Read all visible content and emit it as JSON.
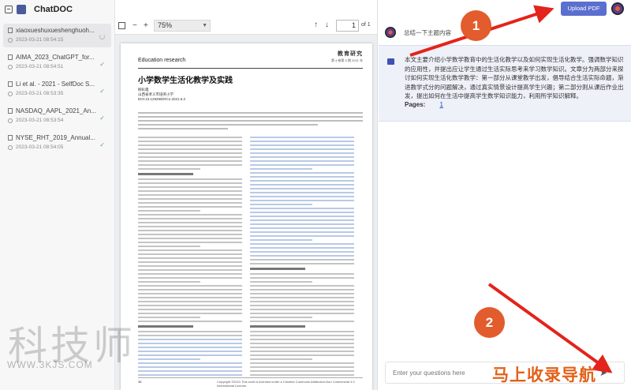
{
  "app": {
    "title": "ChatDOC"
  },
  "sidebar": {
    "items": [
      {
        "name": "xiaoxueshuxueshenghuoh...",
        "time": "2023-03-21 08:54:15",
        "status": "loading",
        "active": true
      },
      {
        "name": "AIMA_2023_ChatGPT_for...",
        "time": "2023-03-21 08:54:51",
        "status": "done",
        "active": false
      },
      {
        "name": "Li et al. - 2021 - SelfDoc S...",
        "time": "2023-03-21 08:53:35",
        "status": "done",
        "active": false
      },
      {
        "name": "NASDAQ_AAPL_2021_An...",
        "time": "2023-03-21 08:53:54",
        "status": "done",
        "active": false
      },
      {
        "name": "NYSE_RHT_2019_Annual...",
        "time": "2023-03-21 08:54:05",
        "status": "done",
        "active": false
      }
    ]
  },
  "viewer": {
    "zoom": "75%",
    "page": "1",
    "page_total": "of 1",
    "pdf": {
      "journal": "Education research",
      "brand": "教育研究",
      "meta": "第 4 卷第 5 期 2021 年",
      "title": "小学数学生活化教学及实践",
      "author_lines": [
        "柳彩霞",
        "山西省孝义市培英小学",
        "DOI:10.12929/ERCn.2021.5.2"
      ],
      "page_number": "38",
      "license": "Copyright ©2021 This work is licensed under a Creative Commons Attribution-Non Commercial 4.0 International License."
    }
  },
  "chat": {
    "upload_label": "Upload PDF",
    "intro": "总结一下主题内容",
    "summary": "本文主要介绍小学数学教育中的生活化教学以及如何实现生活化教学。强调数学知识的应用性，并提出应让学生通过生活实际思考来学习数学知识。文章分为两部分来探讨如何实现生活化数学教学：第一部分从课堂教学出发，倡导结合生活实际命题，渐进教学式分的问题解决，通过真实情景设计提高学生兴趣；第二部分则从课后作业出发，提出如何在生活中提高学生数学知识能力，利用所学知识解释。",
    "pages_label": "Pages:",
    "pages_link": "1",
    "input_placeholder": "Enter your questions here"
  },
  "annotations": {
    "badge1": "1",
    "badge2": "2",
    "arrow_color": "#e3231c"
  },
  "watermarks": {
    "left_text": "科技师",
    "url": "WWW.3KJS.COM",
    "right_text": "马上收录导航"
  },
  "colors": {
    "accent": "#5b6fcf",
    "highlight": "#b9c9e6",
    "summary_bg": "#eef1f8",
    "link": "#1a49c9"
  }
}
